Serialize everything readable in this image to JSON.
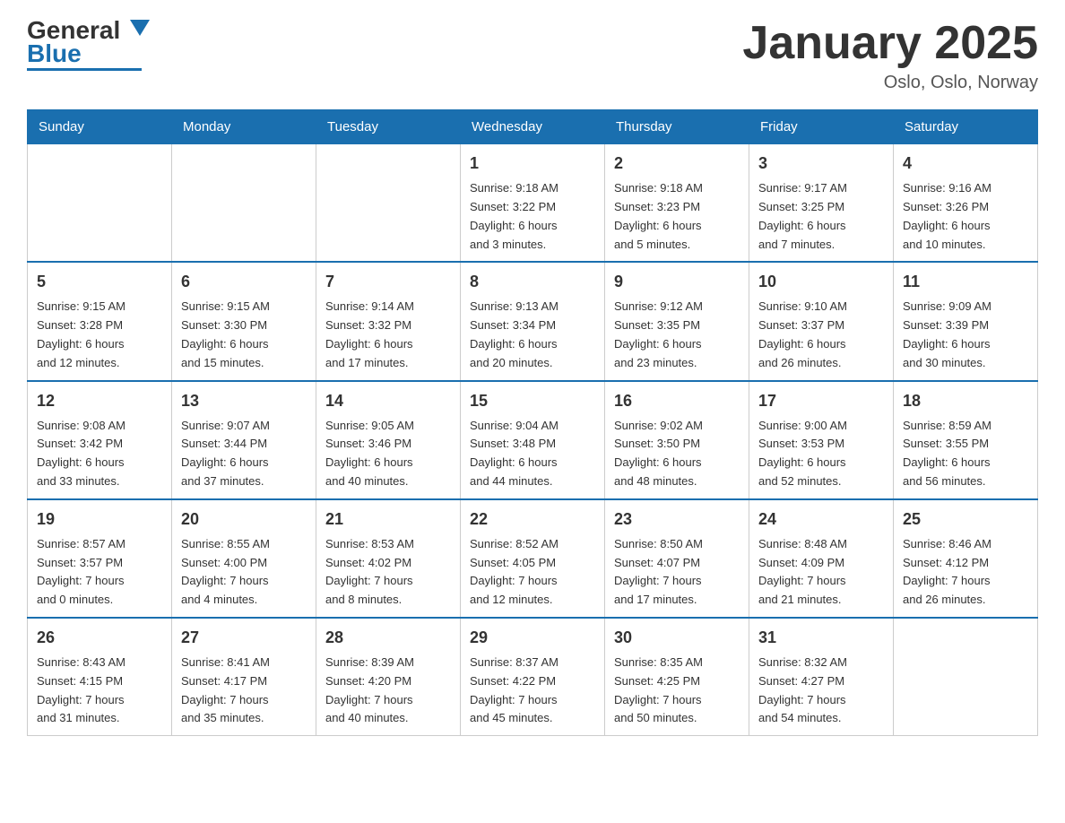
{
  "header": {
    "logo_general": "General",
    "logo_blue": "Blue",
    "title": "January 2025",
    "subtitle": "Oslo, Oslo, Norway"
  },
  "weekdays": [
    "Sunday",
    "Monday",
    "Tuesday",
    "Wednesday",
    "Thursday",
    "Friday",
    "Saturday"
  ],
  "weeks": [
    [
      {
        "day": "",
        "info": ""
      },
      {
        "day": "",
        "info": ""
      },
      {
        "day": "",
        "info": ""
      },
      {
        "day": "1",
        "info": "Sunrise: 9:18 AM\nSunset: 3:22 PM\nDaylight: 6 hours\nand 3 minutes."
      },
      {
        "day": "2",
        "info": "Sunrise: 9:18 AM\nSunset: 3:23 PM\nDaylight: 6 hours\nand 5 minutes."
      },
      {
        "day": "3",
        "info": "Sunrise: 9:17 AM\nSunset: 3:25 PM\nDaylight: 6 hours\nand 7 minutes."
      },
      {
        "day": "4",
        "info": "Sunrise: 9:16 AM\nSunset: 3:26 PM\nDaylight: 6 hours\nand 10 minutes."
      }
    ],
    [
      {
        "day": "5",
        "info": "Sunrise: 9:15 AM\nSunset: 3:28 PM\nDaylight: 6 hours\nand 12 minutes."
      },
      {
        "day": "6",
        "info": "Sunrise: 9:15 AM\nSunset: 3:30 PM\nDaylight: 6 hours\nand 15 minutes."
      },
      {
        "day": "7",
        "info": "Sunrise: 9:14 AM\nSunset: 3:32 PM\nDaylight: 6 hours\nand 17 minutes."
      },
      {
        "day": "8",
        "info": "Sunrise: 9:13 AM\nSunset: 3:34 PM\nDaylight: 6 hours\nand 20 minutes."
      },
      {
        "day": "9",
        "info": "Sunrise: 9:12 AM\nSunset: 3:35 PM\nDaylight: 6 hours\nand 23 minutes."
      },
      {
        "day": "10",
        "info": "Sunrise: 9:10 AM\nSunset: 3:37 PM\nDaylight: 6 hours\nand 26 minutes."
      },
      {
        "day": "11",
        "info": "Sunrise: 9:09 AM\nSunset: 3:39 PM\nDaylight: 6 hours\nand 30 minutes."
      }
    ],
    [
      {
        "day": "12",
        "info": "Sunrise: 9:08 AM\nSunset: 3:42 PM\nDaylight: 6 hours\nand 33 minutes."
      },
      {
        "day": "13",
        "info": "Sunrise: 9:07 AM\nSunset: 3:44 PM\nDaylight: 6 hours\nand 37 minutes."
      },
      {
        "day": "14",
        "info": "Sunrise: 9:05 AM\nSunset: 3:46 PM\nDaylight: 6 hours\nand 40 minutes."
      },
      {
        "day": "15",
        "info": "Sunrise: 9:04 AM\nSunset: 3:48 PM\nDaylight: 6 hours\nand 44 minutes."
      },
      {
        "day": "16",
        "info": "Sunrise: 9:02 AM\nSunset: 3:50 PM\nDaylight: 6 hours\nand 48 minutes."
      },
      {
        "day": "17",
        "info": "Sunrise: 9:00 AM\nSunset: 3:53 PM\nDaylight: 6 hours\nand 52 minutes."
      },
      {
        "day": "18",
        "info": "Sunrise: 8:59 AM\nSunset: 3:55 PM\nDaylight: 6 hours\nand 56 minutes."
      }
    ],
    [
      {
        "day": "19",
        "info": "Sunrise: 8:57 AM\nSunset: 3:57 PM\nDaylight: 7 hours\nand 0 minutes."
      },
      {
        "day": "20",
        "info": "Sunrise: 8:55 AM\nSunset: 4:00 PM\nDaylight: 7 hours\nand 4 minutes."
      },
      {
        "day": "21",
        "info": "Sunrise: 8:53 AM\nSunset: 4:02 PM\nDaylight: 7 hours\nand 8 minutes."
      },
      {
        "day": "22",
        "info": "Sunrise: 8:52 AM\nSunset: 4:05 PM\nDaylight: 7 hours\nand 12 minutes."
      },
      {
        "day": "23",
        "info": "Sunrise: 8:50 AM\nSunset: 4:07 PM\nDaylight: 7 hours\nand 17 minutes."
      },
      {
        "day": "24",
        "info": "Sunrise: 8:48 AM\nSunset: 4:09 PM\nDaylight: 7 hours\nand 21 minutes."
      },
      {
        "day": "25",
        "info": "Sunrise: 8:46 AM\nSunset: 4:12 PM\nDaylight: 7 hours\nand 26 minutes."
      }
    ],
    [
      {
        "day": "26",
        "info": "Sunrise: 8:43 AM\nSunset: 4:15 PM\nDaylight: 7 hours\nand 31 minutes."
      },
      {
        "day": "27",
        "info": "Sunrise: 8:41 AM\nSunset: 4:17 PM\nDaylight: 7 hours\nand 35 minutes."
      },
      {
        "day": "28",
        "info": "Sunrise: 8:39 AM\nSunset: 4:20 PM\nDaylight: 7 hours\nand 40 minutes."
      },
      {
        "day": "29",
        "info": "Sunrise: 8:37 AM\nSunset: 4:22 PM\nDaylight: 7 hours\nand 45 minutes."
      },
      {
        "day": "30",
        "info": "Sunrise: 8:35 AM\nSunset: 4:25 PM\nDaylight: 7 hours\nand 50 minutes."
      },
      {
        "day": "31",
        "info": "Sunrise: 8:32 AM\nSunset: 4:27 PM\nDaylight: 7 hours\nand 54 minutes."
      },
      {
        "day": "",
        "info": ""
      }
    ]
  ]
}
